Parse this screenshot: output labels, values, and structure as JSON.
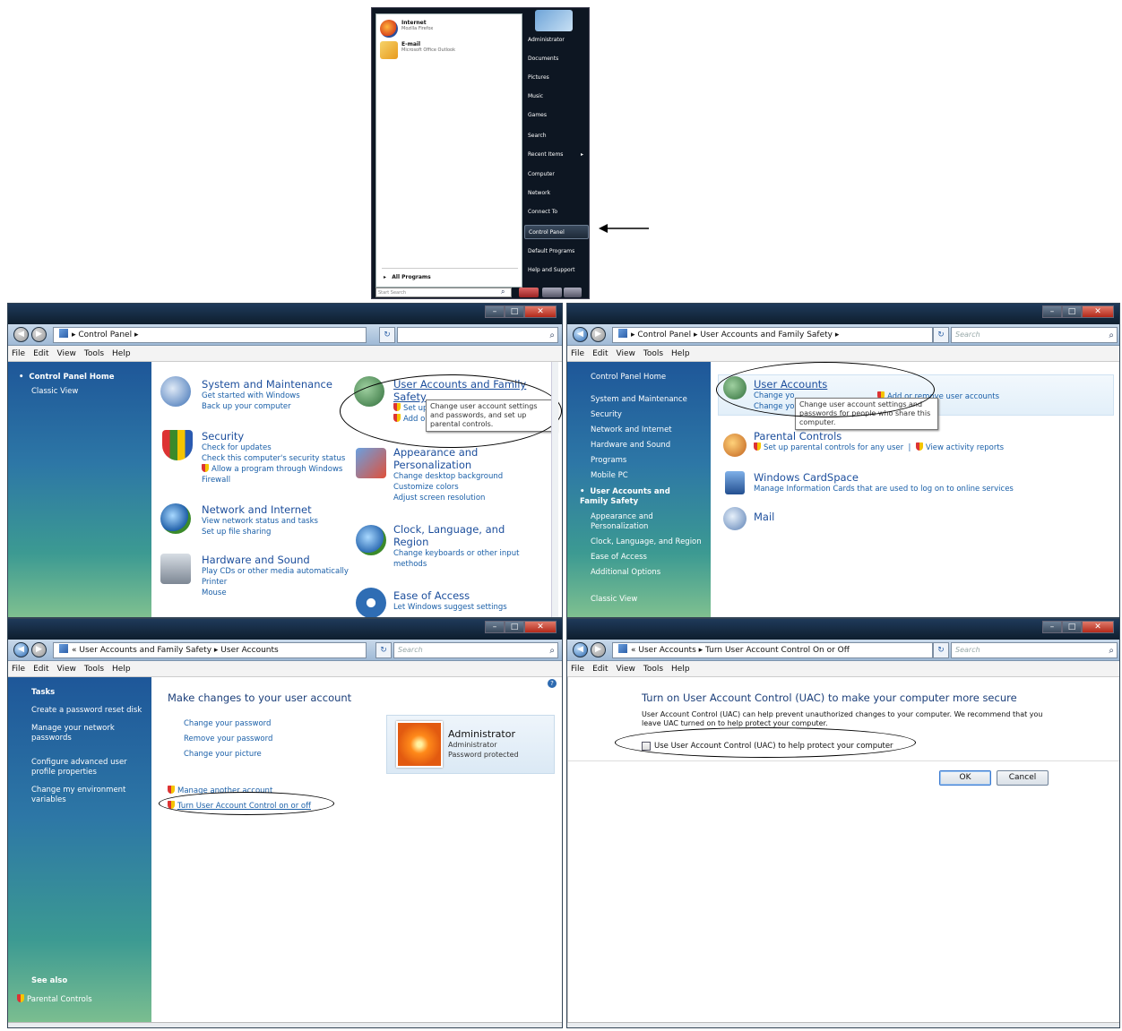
{
  "start_menu": {
    "pinned": [
      {
        "title": "Internet",
        "subtitle": "Mozilla Firefox",
        "icon": "firefox-icon"
      },
      {
        "title": "E-mail",
        "subtitle": "Microsoft Office Outlook",
        "icon": "outlook-icon"
      }
    ],
    "all_programs": "All Programs",
    "search_placeholder": "Start Search",
    "right_items": [
      "Administrator",
      "Documents",
      "Pictures",
      "Music",
      "Games",
      "Search",
      "Recent Items",
      "Computer",
      "Network",
      "Connect To",
      "Control Panel",
      "Default Programs",
      "Help and Support"
    ],
    "selected_item": "Control Panel"
  },
  "menus": [
    "File",
    "Edit",
    "View",
    "Tools",
    "Help"
  ],
  "win1": {
    "breadcrumb": "Control Panel",
    "search_value": "",
    "sidebar": [
      "Control Panel Home",
      "Classic View"
    ],
    "categories": [
      {
        "title": "System and Maintenance",
        "links": [
          "Get started with Windows",
          "Back up your computer"
        ]
      },
      {
        "title": "Security",
        "links": [
          "Check for updates",
          "Check this computer's security status",
          "Allow a program through Windows Firewall"
        ]
      },
      {
        "title": "Network and Internet",
        "links": [
          "View network status and tasks",
          "Set up file sharing"
        ]
      },
      {
        "title": "Hardware and Sound",
        "links": [
          "Play CDs or other media automatically",
          "Printer",
          "Mouse"
        ]
      },
      {
        "title": "User Accounts and Family Safety",
        "links": [
          "Set up",
          "Add o"
        ]
      },
      {
        "title": "Appearance and Personalization",
        "links": [
          "Change desktop background",
          "Customize colors",
          "Adjust screen resolution"
        ]
      },
      {
        "title": "Clock, Language, and Region",
        "links": [
          "Change keyboards or other input methods"
        ]
      },
      {
        "title": "Ease of Access",
        "links": [
          "Let Windows suggest settings"
        ]
      }
    ],
    "tooltip": "Change user account settings and passwords, and set up parental controls."
  },
  "win2": {
    "breadcrumb": [
      "Control Panel",
      "User Accounts and Family Safety"
    ],
    "search_placeholder": "Search",
    "sidebar": [
      "Control Panel Home",
      "System and Maintenance",
      "Security",
      "Network and Internet",
      "Hardware and Sound",
      "Programs",
      "Mobile PC",
      "User Accounts and Family Safety",
      "Appearance and Personalization",
      "Clock, Language, and Region",
      "Ease of Access",
      "Additional Options",
      "Classic View"
    ],
    "items": [
      {
        "title": "User Accounts",
        "links": [
          "Change yo",
          "Add or remove user accounts",
          "Change yo"
        ]
      },
      {
        "title": "Parental Controls",
        "links": [
          "Set up parental controls for any user",
          "View activity reports"
        ]
      },
      {
        "title": "Windows CardSpace",
        "links": [
          "Manage Information Cards that are used to log on to online services"
        ]
      },
      {
        "title": "Mail",
        "links": []
      }
    ],
    "tooltip": "Change user account settings and passwords for people who share this computer."
  },
  "win3": {
    "breadcrumb": [
      "User Accounts and Family Safety",
      "User Accounts"
    ],
    "search_placeholder": "Search",
    "tasks_heading": "Tasks",
    "tasks": [
      "Create a password reset disk",
      "Manage your network passwords",
      "Configure advanced user profile properties",
      "Change my environment variables"
    ],
    "see_also": "See also",
    "see_also_link": "Parental Controls",
    "heading": "Make changes to your user account",
    "links": [
      "Change your password",
      "Remove your password",
      "Change your picture"
    ],
    "manage_link": "Manage another account",
    "uac_link": "Turn User Account Control on or off",
    "account": {
      "name": "Administrator",
      "type": "Administrator",
      "status": "Password protected"
    }
  },
  "win4": {
    "breadcrumb": [
      "User Accounts",
      "Turn User Account Control On or Off"
    ],
    "search_placeholder": "Search",
    "heading": "Turn on User Account Control (UAC) to make your computer more secure",
    "description": "User Account Control (UAC) can help prevent unauthorized changes to your computer.  We recommend that you leave UAC turned on to help protect your computer.",
    "checkbox_label": "Use User Account Control (UAC) to help protect your computer",
    "checkbox_checked": false,
    "ok": "OK",
    "cancel": "Cancel"
  }
}
